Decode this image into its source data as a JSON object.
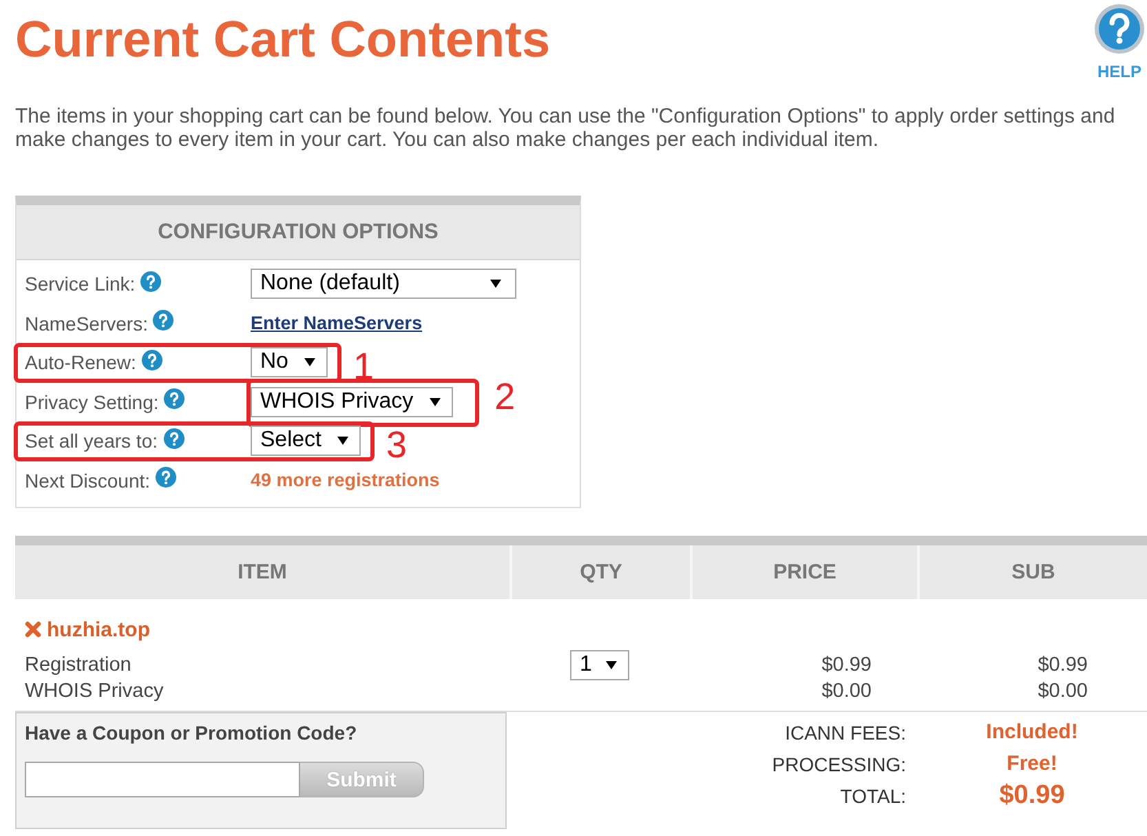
{
  "page": {
    "title": "Current Cart Contents",
    "help_label": "HELP",
    "intro": "The items in your shopping cart can be found below. You can use the \"Configuration Options\" to apply order settings and make changes to every item in your cart. You can also make changes per each individual item."
  },
  "configuration": {
    "heading": "CONFIGURATION OPTIONS",
    "rows": [
      {
        "label": "Service Link:",
        "kind": "select",
        "value": "None (default)"
      },
      {
        "label": "NameServers:",
        "kind": "link",
        "value": "Enter NameServers"
      },
      {
        "label": "Auto-Renew:",
        "kind": "select",
        "value": "No",
        "annotation": {
          "number": "1",
          "kind": "row"
        }
      },
      {
        "label": "Privacy Setting:",
        "kind": "select",
        "value": "WHOIS Privacy",
        "annotation": {
          "number": "2",
          "kind": "control"
        }
      },
      {
        "label": "Set all years to:",
        "kind": "select",
        "value": "Select",
        "annotation": {
          "number": "3",
          "kind": "row"
        }
      },
      {
        "label": "Next Discount:",
        "kind": "notice",
        "value": "49 more registrations"
      }
    ]
  },
  "cart": {
    "columns": [
      "ITEM",
      "QTY",
      "PRICE",
      "SUB"
    ],
    "items": [
      {
        "name": "huzhia.top",
        "quantity": "1",
        "lines": [
          {
            "label": "Registration",
            "price": "$0.99",
            "sub": "$0.99"
          },
          {
            "label": "WHOIS Privacy",
            "price": "$0.00",
            "sub": "$0.00"
          }
        ]
      }
    ]
  },
  "coupon": {
    "heading": "Have a Coupon or Promotion Code?",
    "button": "Submit"
  },
  "totals": [
    {
      "label": "ICANN FEES:",
      "value": "Included!",
      "kind": "fee"
    },
    {
      "label": "PROCESSING:",
      "value": "Free!",
      "kind": "fee"
    },
    {
      "label": "TOTAL:",
      "value": "$0.99",
      "kind": "total"
    }
  ]
}
